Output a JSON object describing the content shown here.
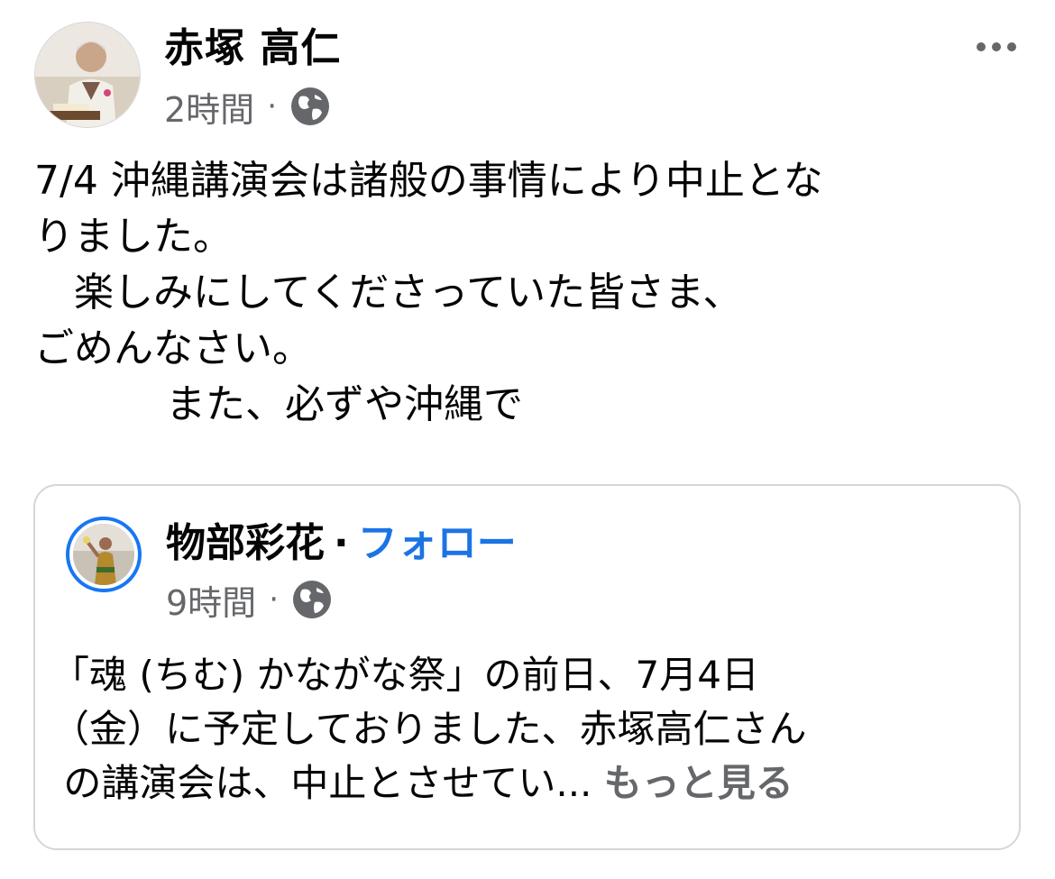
{
  "post": {
    "author": "赤塚 高仁",
    "time": "2時間",
    "separator": "·",
    "privacy_icon": "globe-icon",
    "menu_icon": "more-options-icon",
    "text_lines": [
      "7/4 沖縄講演会は諸般の事情により中止とな",
      "りました。",
      "　楽しみにしてくださっていた皆さま、",
      "ごめんなさい。",
      "　　　 また、必ずや沖縄で"
    ]
  },
  "shared": {
    "author": "物部彩花",
    "separator": "·",
    "follow_label": "フォロー",
    "time": "9時間",
    "privacy_icon": "globe-icon",
    "text_lines": [
      "「魂 (ちむ) かながな祭」の前日、7月4日",
      "（金）に予定しておりました、赤塚高仁さん",
      " の講演会は、中止とさせてい..."
    ],
    "see_more_label": "もっと見る"
  },
  "colors": {
    "accent": "#1b74e4",
    "avatar_ring": "#1877f2",
    "secondary_text": "#65676b",
    "card_border": "#d5d6da"
  }
}
